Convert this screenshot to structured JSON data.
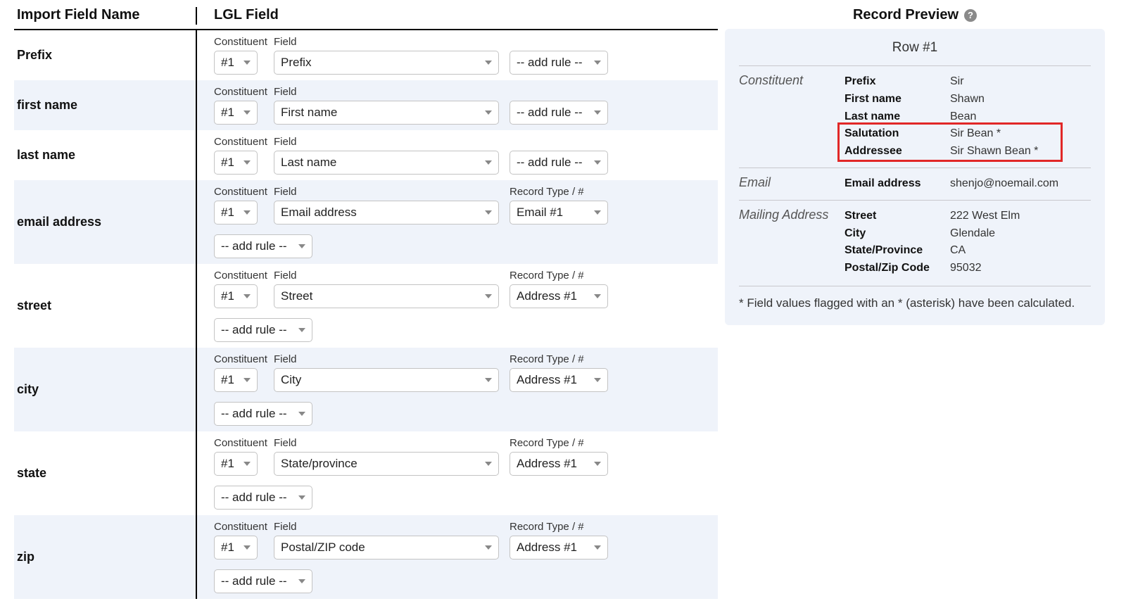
{
  "headers": {
    "import_field_name": "Import Field Name",
    "lgl_field": "LGL Field"
  },
  "labels": {
    "constituent": "Constituent",
    "field": "Field",
    "record_type": "Record Type / #",
    "add_rule": "-- add rule --"
  },
  "rows": [
    {
      "import_name": "Prefix",
      "constituent": "#1",
      "field": "Prefix",
      "record": null,
      "extra_add_rule": false,
      "alt": false
    },
    {
      "import_name": "first name",
      "constituent": "#1",
      "field": "First name",
      "record": null,
      "extra_add_rule": false,
      "alt": true
    },
    {
      "import_name": "last name",
      "constituent": "#1",
      "field": "Last name",
      "record": null,
      "extra_add_rule": false,
      "alt": false
    },
    {
      "import_name": "email address",
      "constituent": "#1",
      "field": "Email address",
      "record": "Email #1",
      "extra_add_rule": true,
      "alt": true
    },
    {
      "import_name": "street",
      "constituent": "#1",
      "field": "Street",
      "record": "Address #1",
      "extra_add_rule": true,
      "alt": false
    },
    {
      "import_name": "city",
      "constituent": "#1",
      "field": "City",
      "record": "Address #1",
      "extra_add_rule": true,
      "alt": true
    },
    {
      "import_name": "state",
      "constituent": "#1",
      "field": "State/province",
      "record": "Address #1",
      "extra_add_rule": true,
      "alt": false
    },
    {
      "import_name": "zip",
      "constituent": "#1",
      "field": "Postal/ZIP code",
      "record": "Address #1",
      "extra_add_rule": true,
      "alt": true
    }
  ],
  "preview": {
    "title": "Record Preview",
    "row_label": "Row #1",
    "footnote": "* Field values flagged with an * (asterisk) have been calculated.",
    "sections": [
      {
        "name": "Constituent",
        "fields": [
          {
            "k": "Prefix",
            "v": "Sir"
          },
          {
            "k": "First name",
            "v": "Shawn"
          },
          {
            "k": "Last name",
            "v": "Bean"
          },
          {
            "k": "Salutation",
            "v": "Sir Bean *"
          },
          {
            "k": "Addressee",
            "v": "Sir Shawn Bean *"
          }
        ]
      },
      {
        "name": "Email",
        "fields": [
          {
            "k": "Email address",
            "v": "shenjo@noemail.com"
          }
        ]
      },
      {
        "name": "Mailing Address",
        "fields": [
          {
            "k": "Street",
            "v": "222 West Elm"
          },
          {
            "k": "City",
            "v": "Glendale"
          },
          {
            "k": "State/Province",
            "v": "CA"
          },
          {
            "k": "Postal/Zip Code",
            "v": "95032"
          }
        ]
      }
    ]
  }
}
